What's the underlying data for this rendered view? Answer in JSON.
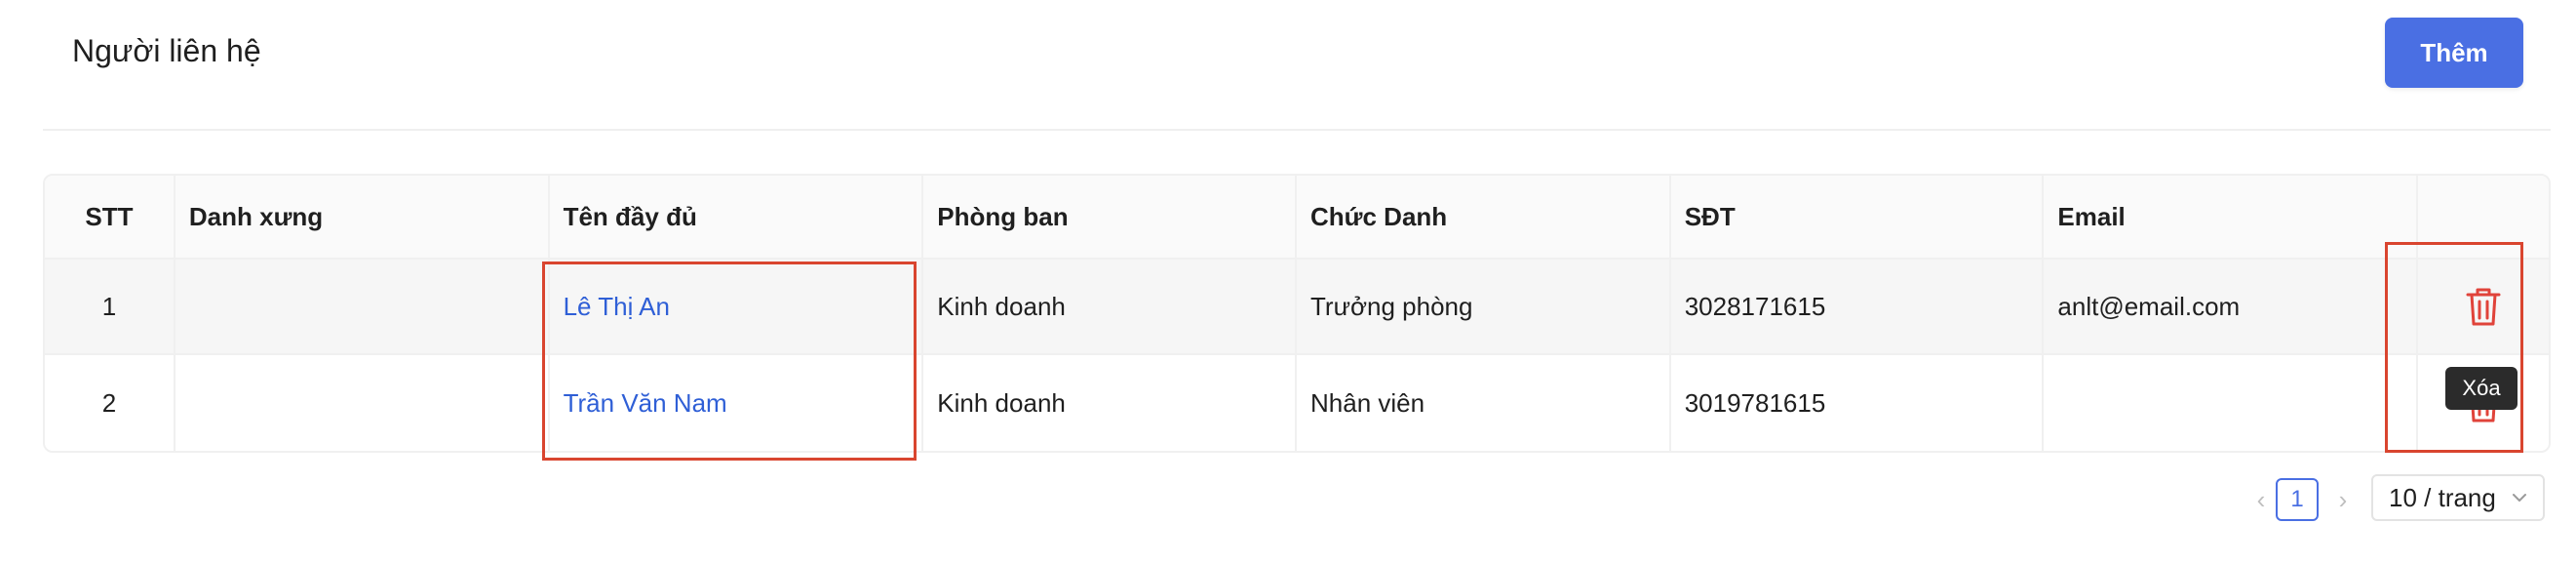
{
  "header": {
    "title": "Người liên hệ",
    "add_label": "Thêm"
  },
  "table": {
    "columns": [
      "STT",
      "Danh xưng",
      "Tên đầy đủ",
      "Phòng ban",
      "Chức Danh",
      "SĐT",
      "Email",
      ""
    ],
    "rows": [
      {
        "stt": "1",
        "title": "",
        "full_name": "Lê Thị An",
        "department": "Kinh doanh",
        "position": "Trưởng phòng",
        "phone": "3028171615",
        "email": "anlt@email.com"
      },
      {
        "stt": "2",
        "title": "",
        "full_name": "Trần Văn Nam",
        "department": "Kinh doanh",
        "position": "Nhân viên",
        "phone": "3019781615",
        "email": ""
      }
    ]
  },
  "tooltip": {
    "delete": "Xóa"
  },
  "pagination": {
    "prev_icon": "chevron-left-icon",
    "next_icon": "chevron-right-icon",
    "current_page": "1",
    "page_size": "10 / trang"
  },
  "colors": {
    "primary": "#4a6fe3",
    "link": "#2f5fd6",
    "danger": "#e0433a",
    "highlight": "#d9452f"
  }
}
